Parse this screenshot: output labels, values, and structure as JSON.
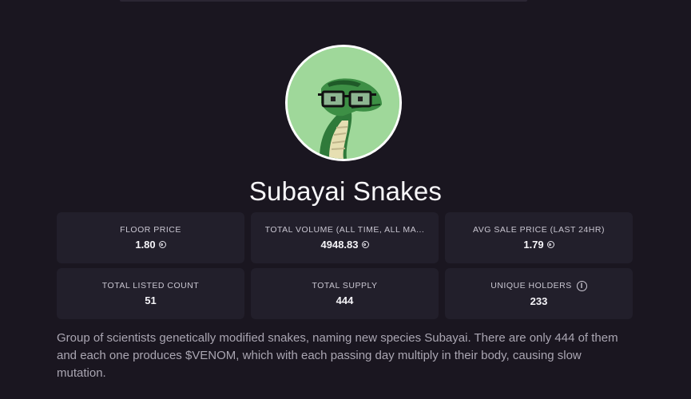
{
  "collection": {
    "name": "Subayai Snakes",
    "avatar_icon": "snake-with-glasses-avatar",
    "description": "Group of scientists genetically modified snakes, naming new species Subayai. There are only 444 of them and each one produces $VENOM, which with each passing day multiply in their body, causing slow mutation."
  },
  "stats": [
    {
      "label": "FLOOR PRICE",
      "value": "1.80",
      "currency_icon": "sol-icon"
    },
    {
      "label": "TOTAL VOLUME (ALL TIME, ALL MA...",
      "value": "4948.83",
      "currency_icon": "sol-icon"
    },
    {
      "label": "AVG SALE PRICE (LAST 24HR)",
      "value": "1.79",
      "currency_icon": "sol-icon"
    },
    {
      "label": "TOTAL LISTED COUNT",
      "value": "51"
    },
    {
      "label": "TOTAL SUPPLY",
      "value": "444"
    },
    {
      "label": "UNIQUE HOLDERS",
      "value": "233",
      "info_icon": "info-icon"
    }
  ],
  "colors": {
    "background": "#1a1620",
    "card": "#221f2b",
    "avatar_bg": "#9fd89a"
  }
}
